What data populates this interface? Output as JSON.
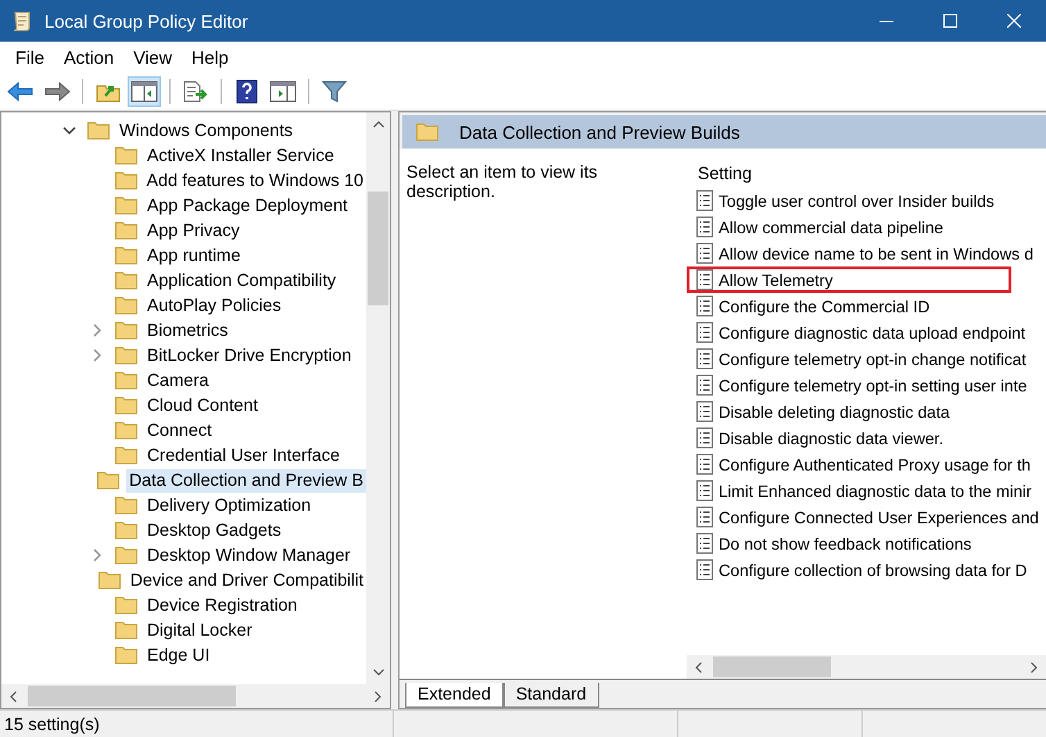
{
  "window": {
    "title": "Local Group Policy Editor"
  },
  "menu": [
    {
      "label": "File"
    },
    {
      "label": "Action"
    },
    {
      "label": "View"
    },
    {
      "label": "Help"
    }
  ],
  "toolbar": [
    {
      "selected": false,
      "disabled": false
    },
    {
      "selected": false,
      "disabled": true
    },
    {
      "selected": false,
      "disabled": false
    },
    {
      "selected": true,
      "disabled": false
    },
    {
      "selected": false,
      "disabled": false
    },
    {
      "selected": false,
      "disabled": false
    },
    {
      "selected": false,
      "disabled": false
    },
    {
      "selected": false,
      "disabled": false
    }
  ],
  "tree": [
    {
      "label": "Windows Components",
      "expanded": true,
      "selected": false,
      "children": [
        {
          "label": "ActiveX Installer Service",
          "expandable": false,
          "selected": false
        },
        {
          "label": "Add features to Windows 10",
          "expandable": false,
          "selected": false
        },
        {
          "label": "App Package Deployment",
          "expandable": false,
          "selected": false
        },
        {
          "label": "App Privacy",
          "expandable": false,
          "selected": false
        },
        {
          "label": "App runtime",
          "expandable": false,
          "selected": false
        },
        {
          "label": "Application Compatibility",
          "expandable": false,
          "selected": false
        },
        {
          "label": "AutoPlay Policies",
          "expandable": false,
          "selected": false
        },
        {
          "label": "Biometrics",
          "expandable": true,
          "selected": false
        },
        {
          "label": "BitLocker Drive Encryption",
          "expandable": true,
          "selected": false
        },
        {
          "label": "Camera",
          "expandable": false,
          "selected": false
        },
        {
          "label": "Cloud Content",
          "expandable": false,
          "selected": false
        },
        {
          "label": "Connect",
          "expandable": false,
          "selected": false
        },
        {
          "label": "Credential User Interface",
          "expandable": false,
          "selected": false
        },
        {
          "label": "Data Collection and Preview B",
          "expandable": false,
          "selected": true
        },
        {
          "label": "Delivery Optimization",
          "expandable": false,
          "selected": false
        },
        {
          "label": "Desktop Gadgets",
          "expandable": false,
          "selected": false
        },
        {
          "label": "Desktop Window Manager",
          "expandable": true,
          "selected": false
        },
        {
          "label": "Device and Driver Compatibilit",
          "expandable": false,
          "selected": false
        },
        {
          "label": "Device Registration",
          "expandable": false,
          "selected": false
        },
        {
          "label": "Digital Locker",
          "expandable": false,
          "selected": false
        },
        {
          "label": "Edge UI",
          "expandable": false,
          "selected": false
        }
      ]
    }
  ],
  "details": {
    "title": "Data Collection and Preview Builds",
    "description": "Select an item to view its description.",
    "column": "Setting",
    "settings": [
      {
        "label": "Toggle user control over Insider builds",
        "highlighted": false
      },
      {
        "label": "Allow commercial data pipeline",
        "highlighted": false
      },
      {
        "label": "Allow device name to be sent in Windows d",
        "highlighted": false
      },
      {
        "label": "Allow Telemetry",
        "highlighted": true
      },
      {
        "label": "Configure the Commercial ID",
        "highlighted": false
      },
      {
        "label": "Configure diagnostic data upload endpoint",
        "highlighted": false
      },
      {
        "label": "Configure telemetry opt-in change notificat",
        "highlighted": false
      },
      {
        "label": "Configure telemetry opt-in setting user inte",
        "highlighted": false
      },
      {
        "label": "Disable deleting diagnostic data",
        "highlighted": false
      },
      {
        "label": "Disable diagnostic data viewer.",
        "highlighted": false
      },
      {
        "label": "Configure Authenticated Proxy usage for th",
        "highlighted": false
      },
      {
        "label": "Limit Enhanced diagnostic data to the minir",
        "highlighted": false
      },
      {
        "label": "Configure Connected User Experiences and",
        "highlighted": false
      },
      {
        "label": "Do not show feedback notifications",
        "highlighted": false
      },
      {
        "label": "Configure collection of browsing data for D",
        "highlighted": false
      }
    ]
  },
  "tabs": [
    {
      "label": "Extended",
      "selected": true
    },
    {
      "label": "Standard",
      "selected": false
    }
  ],
  "status_bar": {
    "text": "15 setting(s)"
  }
}
